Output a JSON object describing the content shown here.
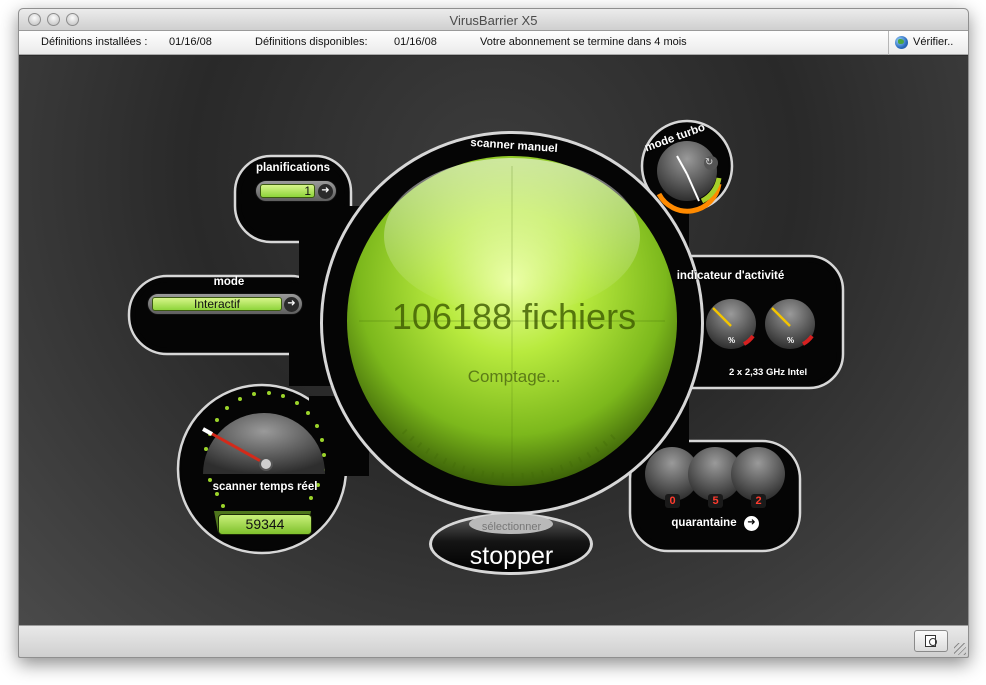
{
  "window": {
    "title": "VirusBarrier X5"
  },
  "infobar": {
    "installed_label": "Définitions installées :",
    "installed_date": "01/16/08",
    "available_label": "Définitions disponibles:",
    "available_date": "01/16/08",
    "subscription": "Votre abonnement se termine dans 4 mois",
    "verify_label": "Vérifier.."
  },
  "schedules": {
    "label": "planifications",
    "value": "1"
  },
  "mode": {
    "label": "mode",
    "value": "Interactif"
  },
  "scanner": {
    "label": "scanner manuel",
    "file_count": "106188 fichiers",
    "status": "Comptage..."
  },
  "turbo": {
    "label": "mode turbo"
  },
  "activity": {
    "label": "indicateur d'activité",
    "cpu_info": "2 x 2,33 GHz Intel",
    "unit": "%"
  },
  "realtime": {
    "label": "scanner temps réel",
    "count": "59344"
  },
  "quarantine": {
    "label": "quarantaine",
    "counts": [
      "0",
      "5",
      "2"
    ]
  },
  "stop_button": {
    "select_label": "sélectionner",
    "stop_label": "stopper"
  },
  "colors": {
    "accent_green": "#9bd42a",
    "background": "#2c2c2c",
    "alert_red": "#ff3b2e"
  },
  "icons": [
    "globe-icon",
    "arrow-right-icon",
    "log-viewer-icon",
    "resize-grip-icon"
  ]
}
